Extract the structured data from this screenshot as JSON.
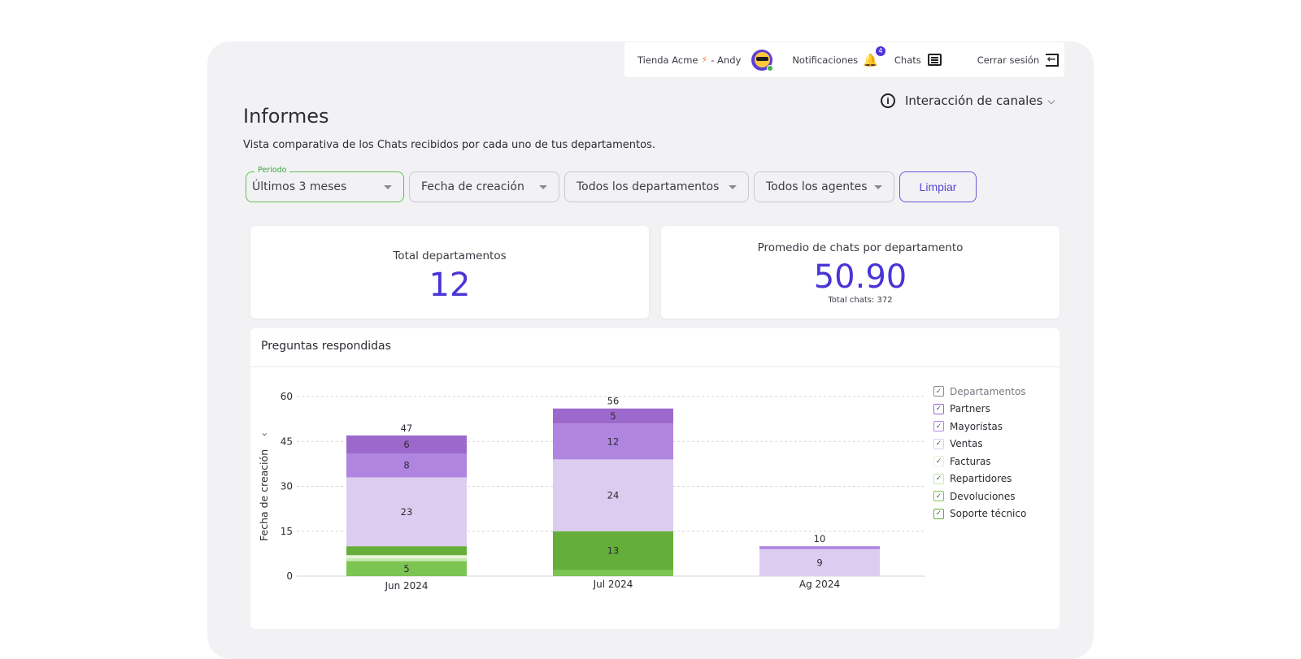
{
  "topbar": {
    "store_name": "Tienda Acme",
    "separator": "- Andy",
    "notifications_label": "Notificaciones",
    "notifications_count": "4",
    "chats_label": "Chats",
    "logout_label": "Cerrar sesión"
  },
  "icons": {
    "bolt": "⚡",
    "bell": "🔔",
    "info": "i",
    "chevron": "⌄",
    "logout": "←"
  },
  "view_selector": {
    "label": "Interacción de canales"
  },
  "page": {
    "title": "Informes",
    "subtitle": "Vista comparativa de los Chats recibidos por cada uno de tus departamentos."
  },
  "filters": {
    "period_label": "Periodo",
    "period_value": "Últimos 3 meses",
    "date_type": "Fecha de creación",
    "departments": "Todos los departamentos",
    "agents": "Todos los agentes",
    "clear_label": "Limpiar"
  },
  "stats": {
    "total_departments_label": "Total departamentos",
    "total_departments_value": "12",
    "avg_chats_label": "Promedio de chats por departamento",
    "avg_chats_value": "50.90",
    "total_chats_text": "Total chats: 372"
  },
  "colors": {
    "accent": "#4a35d6",
    "green_active": "#5fbf4d"
  },
  "chart_data": {
    "type": "bar",
    "stacked": true,
    "title": "Preguntas respondidas",
    "xlabel": "",
    "ylabel": "Fecha de creación",
    "ylim": [
      0,
      60
    ],
    "yticks": [
      0,
      15,
      30,
      45,
      60
    ],
    "grid": true,
    "legend_position": "right",
    "legend_title": "Departamentos",
    "categories": [
      "Jun 2024",
      "Jul 2024",
      "Ag 2024"
    ],
    "totals": [
      47,
      56,
      10
    ],
    "series": [
      {
        "name": "Devoluciones",
        "color": "#7dc553",
        "values": [
          5,
          2,
          0
        ]
      },
      {
        "name": "Repartidores",
        "color": "#c7e8b0",
        "values": [
          1,
          0,
          0
        ]
      },
      {
        "name": "Facturas",
        "color": "#e4f4d8",
        "values": [
          1,
          0,
          0
        ]
      },
      {
        "name": "Soporte técnico",
        "color": "#66ae3a",
        "values": [
          3,
          13,
          0
        ]
      },
      {
        "name": "Ventas",
        "color": "#dccdf0",
        "values": [
          23,
          24,
          9
        ]
      },
      {
        "name": "Mayoristas",
        "color": "#b085e0",
        "values": [
          8,
          12,
          1
        ]
      },
      {
        "name": "Partners",
        "color": "#9d68cc",
        "values": [
          6,
          5,
          0
        ]
      }
    ],
    "legend_order": [
      "Partners",
      "Mayoristas",
      "Ventas",
      "Facturas",
      "Repartidores",
      "Devoluciones",
      "Soporte técnico"
    ]
  }
}
